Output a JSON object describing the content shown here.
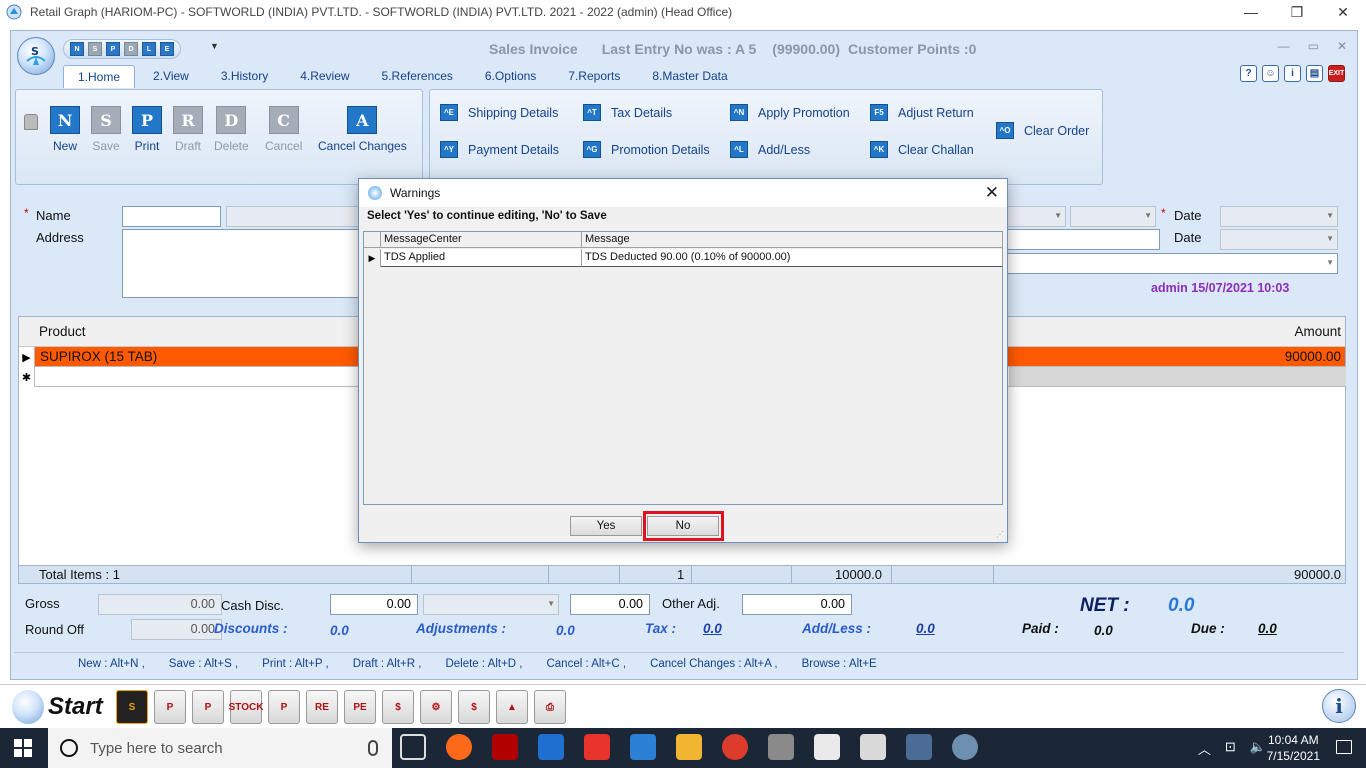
{
  "window": {
    "title": "Retail Graph (HARIOM-PC) - SOFTWORLD (INDIA) PVT.LTD. - SOFTWORLD (INDIA) PVT.LTD.  2021 - 2022 (admin) (Head Office)",
    "minimize": "—",
    "restore": "❐",
    "close": "✕"
  },
  "header": {
    "doc_title": "Sales Invoice",
    "last_entry": "Last Entry No was : A 5",
    "amount": "(99900.00)",
    "customer_points": "Customer Points :0"
  },
  "qat": [
    "N",
    "S",
    "P",
    "D",
    "L",
    "E"
  ],
  "tabs": [
    "1.Home",
    "2.View",
    "3.History",
    "4.Review",
    "5.References",
    "6.Options",
    "7.Reports",
    "8.Master Data"
  ],
  "ribbon": {
    "main_buttons": [
      {
        "label": "New",
        "glyph": "N"
      },
      {
        "label": "Save",
        "glyph": "S"
      },
      {
        "label": "Print",
        "glyph": "P"
      },
      {
        "label": "Draft",
        "glyph": "R"
      },
      {
        "label": "Delete",
        "glyph": "D"
      },
      {
        "label": "Cancel",
        "glyph": "C"
      },
      {
        "label": "Cancel Changes",
        "glyph": "A"
      }
    ],
    "small_buttons": [
      {
        "label": "Shipping Details",
        "key": "^E"
      },
      {
        "label": "Payment Details",
        "key": "^Y"
      },
      {
        "label": "Tax Details",
        "key": "^T"
      },
      {
        "label": "Promotion Details",
        "key": "^G"
      },
      {
        "label": "Apply Promotion",
        "key": "^N"
      },
      {
        "label": "Add/Less",
        "key": "^L"
      },
      {
        "label": "Adjust Return",
        "key": "F5"
      },
      {
        "label": "Clear Challan",
        "key": "^K"
      },
      {
        "label": "Clear Order",
        "key": "^O"
      }
    ]
  },
  "form": {
    "name_label": "Name",
    "address_label": "Address",
    "date_label_1": "Date",
    "date_label_2": "Date",
    "required_mark": "*",
    "stamp": "admin 15/07/2021 10:03"
  },
  "grid": {
    "col_product": "Product",
    "col_amount": "Amount",
    "row_marker": "▶",
    "new_marker": "✱",
    "rows": [
      {
        "product": "SUPIROX (15 TAB)",
        "amount": "90000.00"
      }
    ],
    "footer": {
      "total_items": "Total Items : 1",
      "qty": "1",
      "rate_total": "10000.0",
      "amount_total": "90000.0"
    }
  },
  "totals": {
    "gross_label": "Gross",
    "gross_value": "0.00",
    "round_off_label": "Round Off",
    "round_off_value": "0.00",
    "cash_disc_label": "Cash Disc.",
    "cash_disc_value": "0.00",
    "cash_disc_pct": "0.00",
    "other_adj_label": "Other Adj.",
    "other_adj_value": "0.00",
    "discounts_label": "Discounts :",
    "discounts_value": "0.0",
    "adjustments_label": "Adjustments :",
    "adjustments_value": "0.0",
    "tax_label": "Tax :",
    "tax_value": "0.0",
    "addless_label": "Add/Less :",
    "addless_value": "0.0",
    "net_label": "NET :",
    "net_value": "0.0",
    "paid_label": "Paid :",
    "paid_value": "0.0",
    "due_label": "Due :",
    "due_value": "0.0"
  },
  "shortcuts": [
    "New : Alt+N ,",
    "Save : Alt+S ,",
    "Print : Alt+P ,",
    "Draft : Alt+R ,",
    "Delete : Alt+D ,",
    "Cancel : Alt+C ,",
    "Cancel Changes : Alt+A ,",
    "Browse : Alt+E"
  ],
  "bottombar": {
    "start": "Start",
    "info": "i",
    "icons": [
      "S",
      "P",
      "P",
      "STOCK",
      "P",
      "RE",
      "PE",
      "$",
      "⚙",
      "$",
      "▲",
      "⎙"
    ]
  },
  "dialog": {
    "title": "Warnings",
    "close": "✕",
    "message": "Select 'Yes' to continue editing, 'No' to Save",
    "col_source": "MessageCenter",
    "col_message": "Message",
    "row_marker": "▶",
    "rows": [
      {
        "source": "TDS Applied",
        "message": "TDS Deducted 90.00 (0.10% of 90000.00)"
      }
    ],
    "yes": "Yes",
    "no": "No",
    "grip": "⋰"
  },
  "taskbar": {
    "search_placeholder": "Type here to search",
    "time": "10:04 AM",
    "date": "7/15/2021",
    "tray": [
      "︿",
      "⊡",
      "🔈"
    ],
    "colors": {
      "bg": "#1b2636",
      "search_bg": "#f3f3f3"
    }
  }
}
